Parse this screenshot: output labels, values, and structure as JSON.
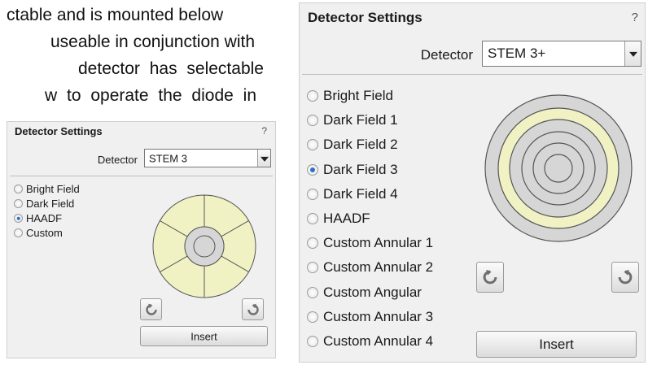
{
  "doc": {
    "lines": [
      "ctable and is mounted below",
      "useable in conjunction with",
      "detector     has     selectable",
      "w   to   operate   the   diode   in"
    ]
  },
  "small_panel": {
    "title": "Detector Settings",
    "help": "?",
    "detector_label": "Detector",
    "detector_value": "STEM 3",
    "options": [
      {
        "label": "Bright Field",
        "checked": false
      },
      {
        "label": "Dark Field",
        "checked": false
      },
      {
        "label": "HAADF",
        "checked": true
      },
      {
        "label": "Custom",
        "checked": false
      }
    ],
    "insert_label": "Insert",
    "rotate_left_icon": "rotate-counterclockwise-icon",
    "rotate_right_icon": "rotate-clockwise-icon",
    "segment_color": "#f0f2c4"
  },
  "large_panel": {
    "title": "Detector Settings",
    "help": "?",
    "detector_label": "Detector",
    "detector_value": "STEM 3+",
    "options": [
      {
        "label": "Bright Field",
        "checked": false
      },
      {
        "label": "Dark Field 1",
        "checked": false
      },
      {
        "label": "Dark Field 2",
        "checked": false
      },
      {
        "label": "Dark Field 3",
        "checked": true
      },
      {
        "label": "Dark Field 4",
        "checked": false
      },
      {
        "label": "HAADF",
        "checked": false
      },
      {
        "label": "Custom Annular 1",
        "checked": false
      },
      {
        "label": "Custom Annular 2",
        "checked": false
      },
      {
        "label": "Custom Angular",
        "checked": false
      },
      {
        "label": "Custom Annular 3",
        "checked": false
      },
      {
        "label": "Custom Annular 4",
        "checked": false
      }
    ],
    "insert_label": "Insert",
    "rotate_left_icon": "rotate-counterclockwise-icon",
    "rotate_right_icon": "rotate-clockwise-icon",
    "highlight_color": "#f0f2c4",
    "ring_color": "#d6d6d6"
  }
}
